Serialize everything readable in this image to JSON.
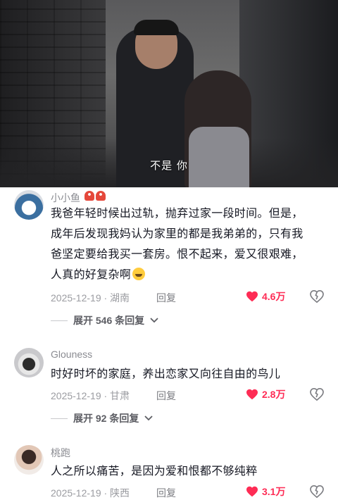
{
  "video": {
    "subtitle": "不是 你"
  },
  "comments": [
    {
      "username": "小小鱼",
      "badges": [
        "mushroom-badge",
        "mushroom-badge"
      ],
      "text_lines": [
        "我爸年轻时候出过轨，抛弃过家一段时间。但是，",
        "成年后发现我妈认为家里的都是我弟弟的，只有我",
        "爸坚定要给我买一套房。恨不起来，爱又很艰难，",
        "人真的好复杂啊"
      ],
      "emoji": "crying-face-emoji",
      "date_location": "2025-12-19 · 湖南",
      "reply_label": "回复",
      "likes": "4.6万",
      "expand_label": "展开 546 条回复"
    },
    {
      "username": "Glouness",
      "text_lines": [
        "时好时坏的家庭，养出恋家又向往自由的鸟儿"
      ],
      "date_location": "2025-12-19 · 甘肃",
      "reply_label": "回复",
      "likes": "2.8万",
      "expand_label": "展开 92 条回复"
    },
    {
      "username": "桃跑",
      "text_lines": [
        "人之所以痛苦，是因为爱和恨都不够纯粹"
      ],
      "date_location": "2025-12-19 · 陕西",
      "reply_label": "回复",
      "likes": "3.1万"
    }
  ],
  "colors": {
    "like_red": "#fe2c55",
    "meta_gray": "#9b9ca1",
    "text_dark": "#161823"
  }
}
